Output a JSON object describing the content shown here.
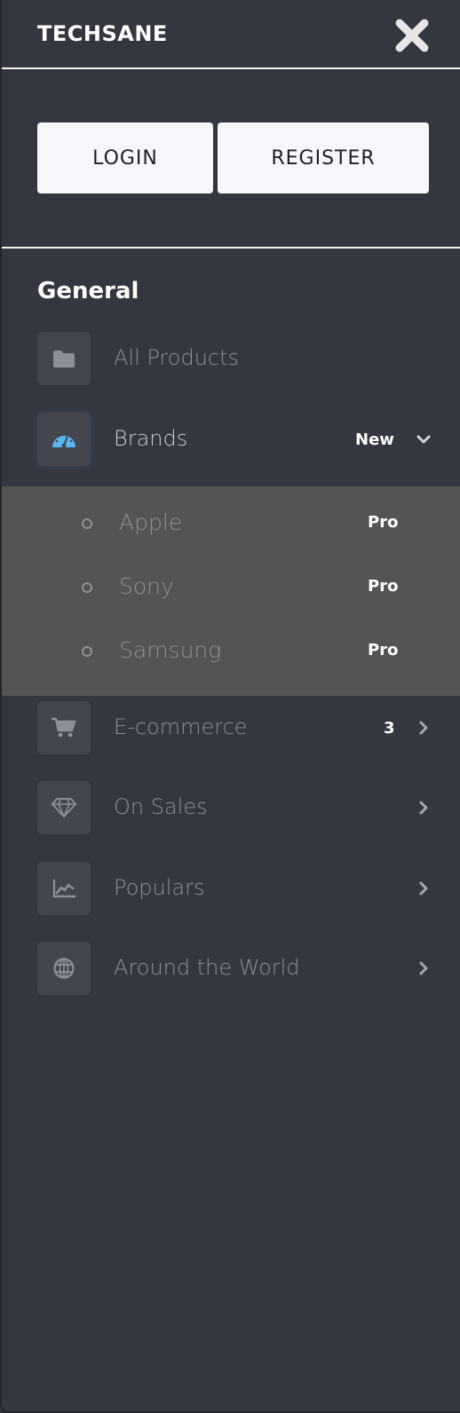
{
  "header": {
    "brand": "TECHSANE",
    "close_icon": "close-icon"
  },
  "auth": {
    "login_label": "LOGIN",
    "register_label": "REGISTER"
  },
  "section": {
    "title": "General"
  },
  "nav": [
    {
      "label": "All Products",
      "icon": "folder-icon",
      "badge": ""
    },
    {
      "label": "Brands",
      "icon": "speedometer-icon",
      "badge": "New",
      "expanded": true
    },
    {
      "label": "E-commerce",
      "icon": "cart-icon",
      "badge": "3"
    },
    {
      "label": "On Sales",
      "icon": "diamond-icon",
      "badge": ""
    },
    {
      "label": "Populars",
      "icon": "chart-icon",
      "badge": ""
    },
    {
      "label": "Around the World",
      "icon": "globe-icon",
      "badge": ""
    }
  ],
  "submenu": [
    {
      "label": "Apple",
      "badge": "Pro"
    },
    {
      "label": "Sony",
      "badge": "Pro"
    },
    {
      "label": "Samsung",
      "badge": "Pro"
    }
  ],
  "colors": {
    "panel_bg": "#343640",
    "submenu_bg": "#545454",
    "accent_icon": "#59b8f2",
    "button_bg": "#f5f7fa"
  }
}
